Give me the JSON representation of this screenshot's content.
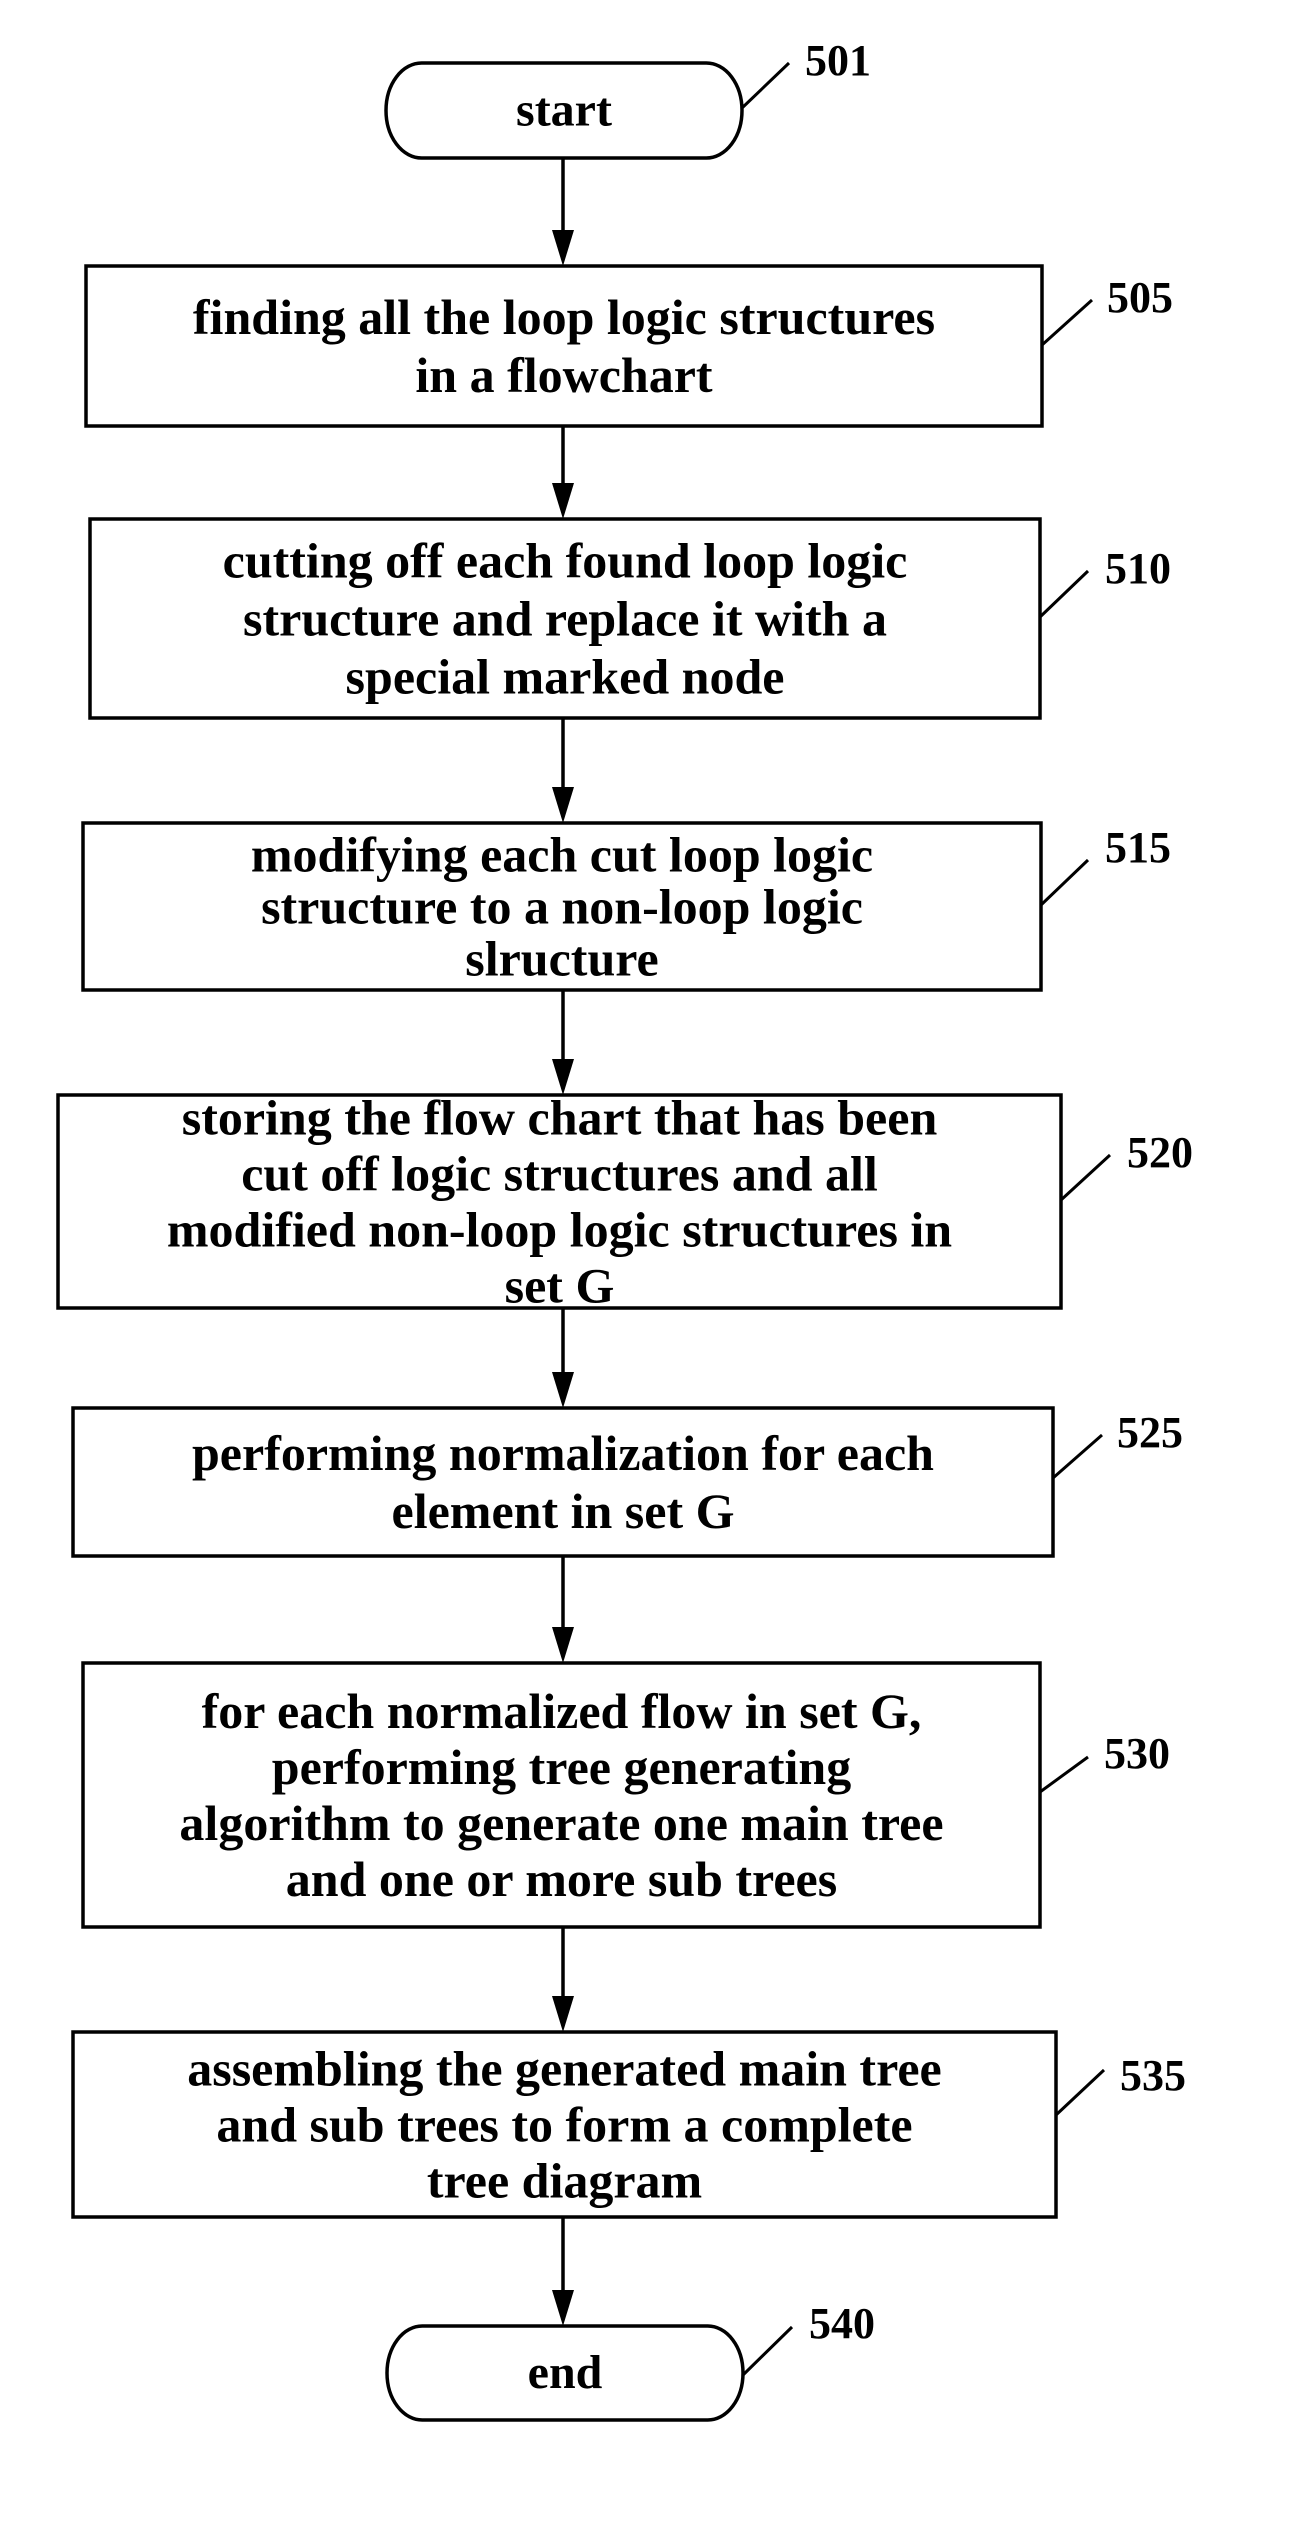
{
  "figure": {
    "type": "flowchart",
    "direction": "top-to-bottom"
  },
  "nodes": [
    {
      "id": "501",
      "kind": "terminator",
      "ref": "501",
      "lines": [
        "start"
      ]
    },
    {
      "id": "505",
      "kind": "process",
      "ref": "505",
      "lines": [
        "finding all the loop logic structures",
        "in a flowchart"
      ]
    },
    {
      "id": "510",
      "kind": "process",
      "ref": "510",
      "lines": [
        "cutting off each found loop logic",
        "structure and replace it with a",
        "special marked node"
      ]
    },
    {
      "id": "515",
      "kind": "process",
      "ref": "515",
      "lines": [
        "modifying each cut loop logic",
        "structure to a non-loop logic",
        "slructure"
      ]
    },
    {
      "id": "520",
      "kind": "process",
      "ref": "520",
      "lines": [
        "storing the flow chart that has been",
        "cut off logic structures and all",
        "modified non-loop logic structures in",
        "set G"
      ]
    },
    {
      "id": "525",
      "kind": "process",
      "ref": "525",
      "lines": [
        "performing normalization for each",
        "element in set  G"
      ]
    },
    {
      "id": "530",
      "kind": "process",
      "ref": "530",
      "lines": [
        "for each normalized flow in set G,",
        "performing tree generating",
        "algorithm to generate one main tree",
        "and one or more sub  trees"
      ]
    },
    {
      "id": "535",
      "kind": "process",
      "ref": "535",
      "lines": [
        "assembling the generated main tree",
        "and sub trees to form a complete",
        "tree diagram"
      ]
    },
    {
      "id": "540",
      "kind": "terminator",
      "ref": "540",
      "lines": [
        "end"
      ]
    }
  ],
  "edges": [
    {
      "from": "501",
      "to": "505"
    },
    {
      "from": "505",
      "to": "510"
    },
    {
      "from": "510",
      "to": "515"
    },
    {
      "from": "515",
      "to": "520"
    },
    {
      "from": "520",
      "to": "525"
    },
    {
      "from": "525",
      "to": "530"
    },
    {
      "from": "530",
      "to": "535"
    },
    {
      "from": "535",
      "to": "540"
    }
  ]
}
